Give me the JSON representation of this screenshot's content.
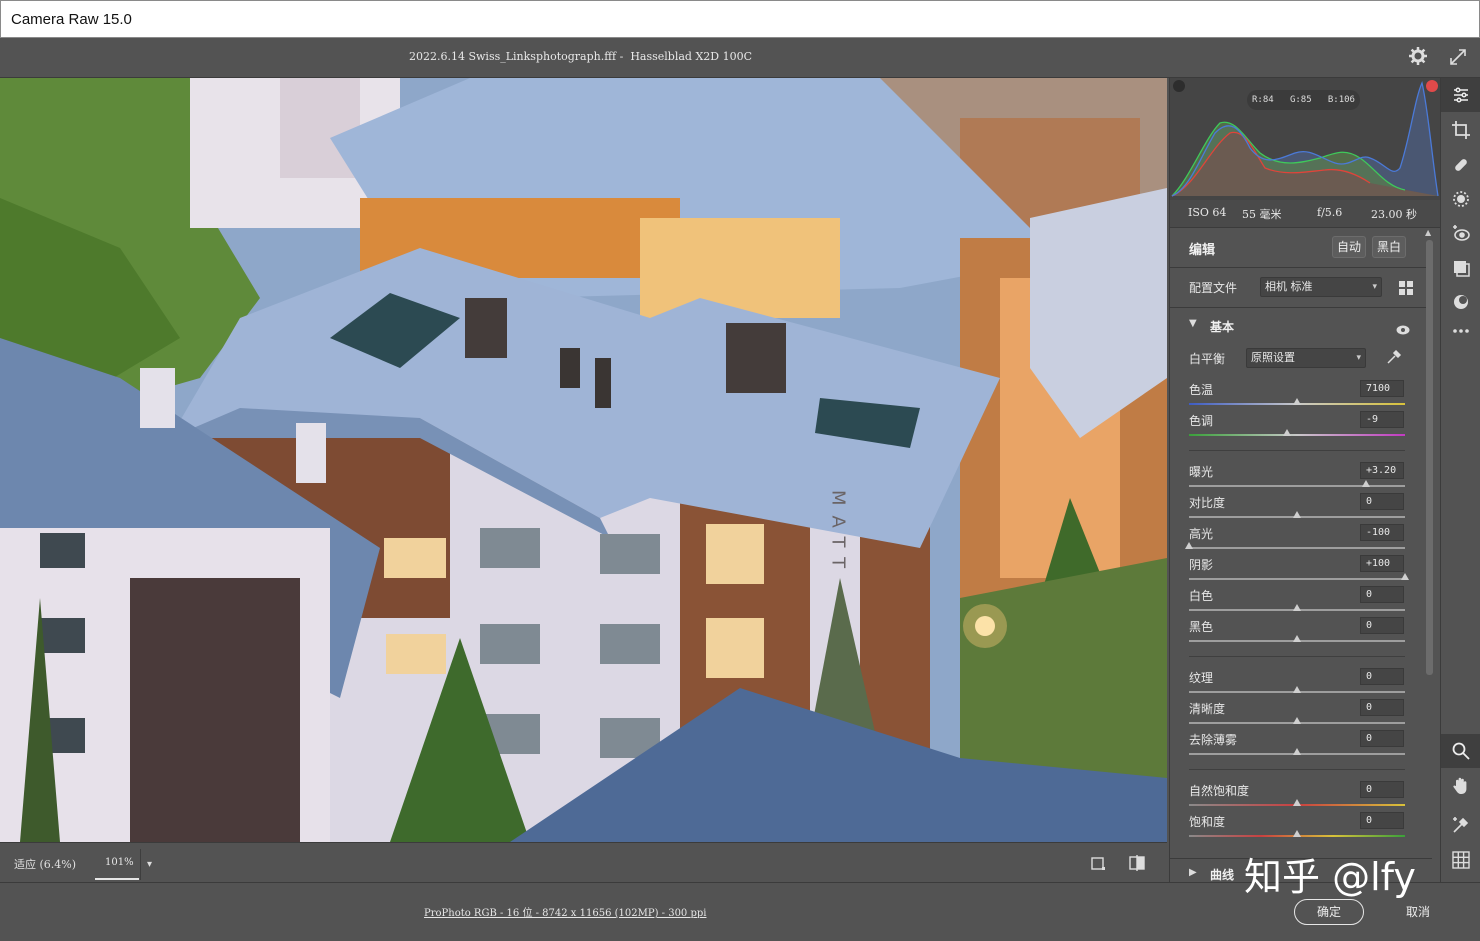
{
  "window": {
    "title": "Camera Raw 15.0"
  },
  "topbar": {
    "filename": "2022.6.14 Swiss_Linksphotograph.fff -  Hasselblad X2D 100C"
  },
  "photo": {
    "sign_text": "MATT"
  },
  "bottom": {
    "zoom_fit": "适应 (6.4%)",
    "zoom_value": "101%"
  },
  "footer": {
    "info": "ProPhoto RGB - 16 位 - 8742 x 11656 (102MP) - 300 ppi",
    "ok_label": "确定",
    "cancel_label": "取消"
  },
  "histogram": {
    "rgb_readout": "R:84   G:85   B:106"
  },
  "exif": {
    "iso": "ISO 64",
    "focal": "55 毫米",
    "aperture": "f/5.6",
    "shutter": "23.00 秒"
  },
  "edit": {
    "title": "编辑",
    "auto_label": "自动",
    "bw_label": "黑白",
    "profile_label": "配置文件",
    "profile_value": "相机 标准",
    "basic_label": "基本",
    "wb_label": "白平衡",
    "wb_value": "原照设置",
    "curve_label": "曲线"
  },
  "sliders": [
    {
      "label": "色温",
      "value": "7100",
      "pos": 0.5
    },
    {
      "label": "色调",
      "value": "-9",
      "pos": 0.455
    },
    {
      "label": "曝光",
      "value": "+3.20",
      "pos": 0.82
    },
    {
      "label": "对比度",
      "value": "0",
      "pos": 0.5
    },
    {
      "label": "高光",
      "value": "-100",
      "pos": 0.0
    },
    {
      "label": "阴影",
      "value": "+100",
      "pos": 1.0
    },
    {
      "label": "白色",
      "value": "0",
      "pos": 0.5
    },
    {
      "label": "黑色",
      "value": "0",
      "pos": 0.5
    },
    {
      "label": "纹理",
      "value": "0",
      "pos": 0.5
    },
    {
      "label": "清晰度",
      "value": "0",
      "pos": 0.5
    },
    {
      "label": "去除薄雾",
      "value": "0",
      "pos": 0.5
    },
    {
      "label": "自然饱和度",
      "value": "0",
      "pos": 0.5
    },
    {
      "label": "饱和度",
      "value": "0",
      "pos": 0.5
    }
  ],
  "watermark": "知乎 @lfy",
  "colors": {
    "background": "#535353",
    "panel_dark": "#454545",
    "clip_warning": "#e14a4a"
  }
}
